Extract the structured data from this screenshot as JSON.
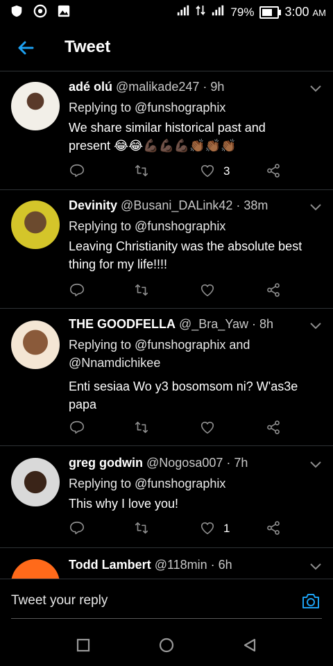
{
  "status_bar": {
    "battery": "79%",
    "time": "3:00",
    "ampm": "AM"
  },
  "header": {
    "title": "Tweet"
  },
  "tweets": [
    {
      "name": "adé olú",
      "handle_time": "@malikade247 · 9h",
      "replying": "Replying to @funshographix",
      "text": "We share similar historical past and present 😂😂💪🏿💪🏿💪🏿👏🏾👏🏾👏🏾",
      "likes": "3"
    },
    {
      "name": "Devinity",
      "handle_time": "@Busani_DALink42 · 38m",
      "replying": "Replying to @funshographix",
      "text": "Leaving Christianity was the absolute best thing for my life!!!!",
      "likes": ""
    },
    {
      "name": "THE GOODFELLA",
      "handle_time": "@_Bra_Yaw · 8h",
      "replying": "Replying to @funshographix and @Nnamdichikee",
      "text": "Enti sesiaa Wo y3 bosomsom ni? W'as3e papa",
      "likes": ""
    },
    {
      "name": "greg godwin",
      "handle_time": "@Nogosa007 · 7h",
      "replying": "Replying to @funshographix",
      "text": "This why I love you!",
      "likes": "1"
    },
    {
      "name": "Todd Lambert",
      "handle_time": "@118min · 6h",
      "replying": "",
      "text": "",
      "likes": ""
    }
  ],
  "reply_bar": {
    "placeholder": "Tweet your reply"
  },
  "colors": {
    "accent": "#1da1f2",
    "divider": "#2f3336",
    "icon_gray": "#8e8e8e"
  },
  "icons": [
    "back-arrow-icon",
    "reply-icon",
    "retweet-icon",
    "heart-icon",
    "share-icon",
    "camera-icon",
    "chevron-down-icon"
  ]
}
